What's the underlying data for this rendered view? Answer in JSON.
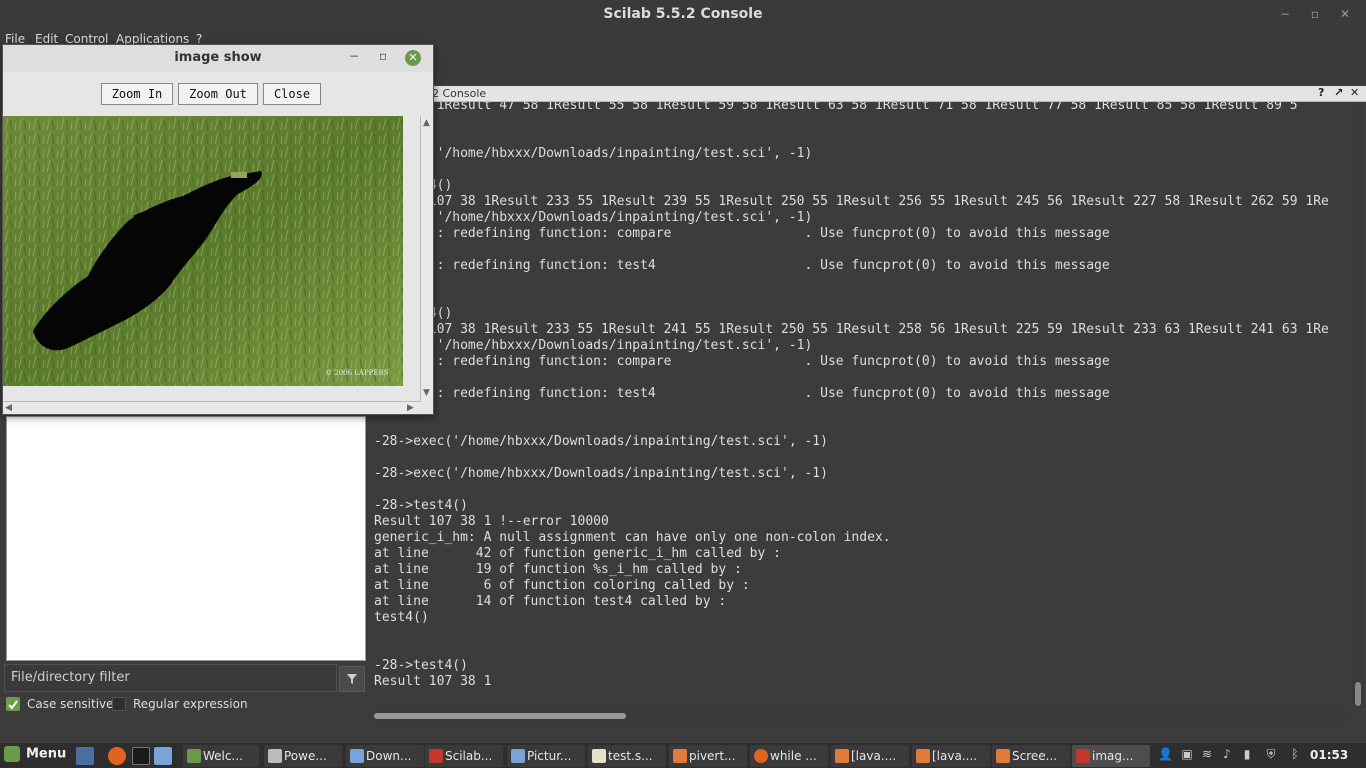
{
  "window": {
    "title": "Scilab 5.5.2 Console",
    "minimize": "−",
    "restore": "▫",
    "close": "✕"
  },
  "menubar": {
    "items": [
      "File",
      "Edit",
      "Control",
      "Applications",
      "?"
    ]
  },
  "console_header": {
    "label": "2 Console",
    "help": "?",
    "undock": "↗",
    "close": "✕"
  },
  "console": {
    "lines": [
      "  81 81 1Result 47 58 1Result 55 58 1Result 59 58 1Result 63 58 1Result 71 58 1Result 77 58 1Result 85 58 1Result 89 5",
      "",
      "-->exec('/home/hbxxx/Downloads/inpainting/test.sci', -1)",
      "",
      "-->test4()",
      "Result 107 38 1Result 233 55 1Result 239 55 1Result 250 55 1Result 256 55 1Result 245 56 1Result 227 58 1Result 262 59 1Re",
      "-->exec('/home/hbxxx/Downloads/inpainting/test.sci', -1)",
      "Warning : redefining function: compare                 . Use funcprot(0) to avoid this message",
      "",
      "Warning : redefining function: test4                   . Use funcprot(0) to avoid this message",
      "",
      "",
      "-->test4()",
      "Result 107 38 1Result 233 55 1Result 241 55 1Result 250 55 1Result 258 56 1Result 225 59 1Result 233 63 1Result 241 63 1Re",
      "-->exec('/home/hbxxx/Downloads/inpainting/test.sci', -1)",
      "Warning : redefining function: compare                 . Use funcprot(0) to avoid this message",
      "",
      "Warning : redefining function: test4                   . Use funcprot(0) to avoid this message",
      "",
      "",
      "-28->exec('/home/hbxxx/Downloads/inpainting/test.sci', -1)",
      "",
      "-28->exec('/home/hbxxx/Downloads/inpainting/test.sci', -1)",
      "",
      "-28->test4()",
      "Result 107 38 1 !--error 10000",
      "generic_i_hm: A null assignment can have only one non-colon index.",
      "at line      42 of function generic_i_hm called by :",
      "at line      19 of function %s_i_hm called by :",
      "at line       6 of function coloring called by :",
      "at line      14 of function test4 called by :",
      "test4()",
      "",
      "",
      "-28->test4()",
      "Result 107 38 1"
    ]
  },
  "file_browser": {
    "filter_placeholder": "File/directory filter",
    "filter_icon": "funnel-icon",
    "case_sensitive_label": "Case sensitive",
    "case_sensitive_checked": true,
    "regex_label": "Regular expression",
    "regex_checked": false
  },
  "image_window": {
    "title": "image show",
    "minimize": "−",
    "maximize": "▫",
    "close": "✕",
    "zoom_in_label": "Zoom In",
    "zoom_out_label": "Zoom Out",
    "close_label": "Close",
    "watermark": "© 2006 LAPPERS"
  },
  "taskbar": {
    "menu_label": "Menu",
    "tasks": [
      "Welc...",
      "Powe...",
      "Down...",
      "Scilab...",
      "Pictur...",
      "test.s...",
      "pivert...",
      "while ...",
      "[lava....",
      "[lava....",
      "Scree...",
      "imag..."
    ],
    "clock": "01:53"
  },
  "colors": {
    "accent_green": "#6a9a4a",
    "console_bg": "#3c3c3c",
    "console_text": "#dedede"
  }
}
